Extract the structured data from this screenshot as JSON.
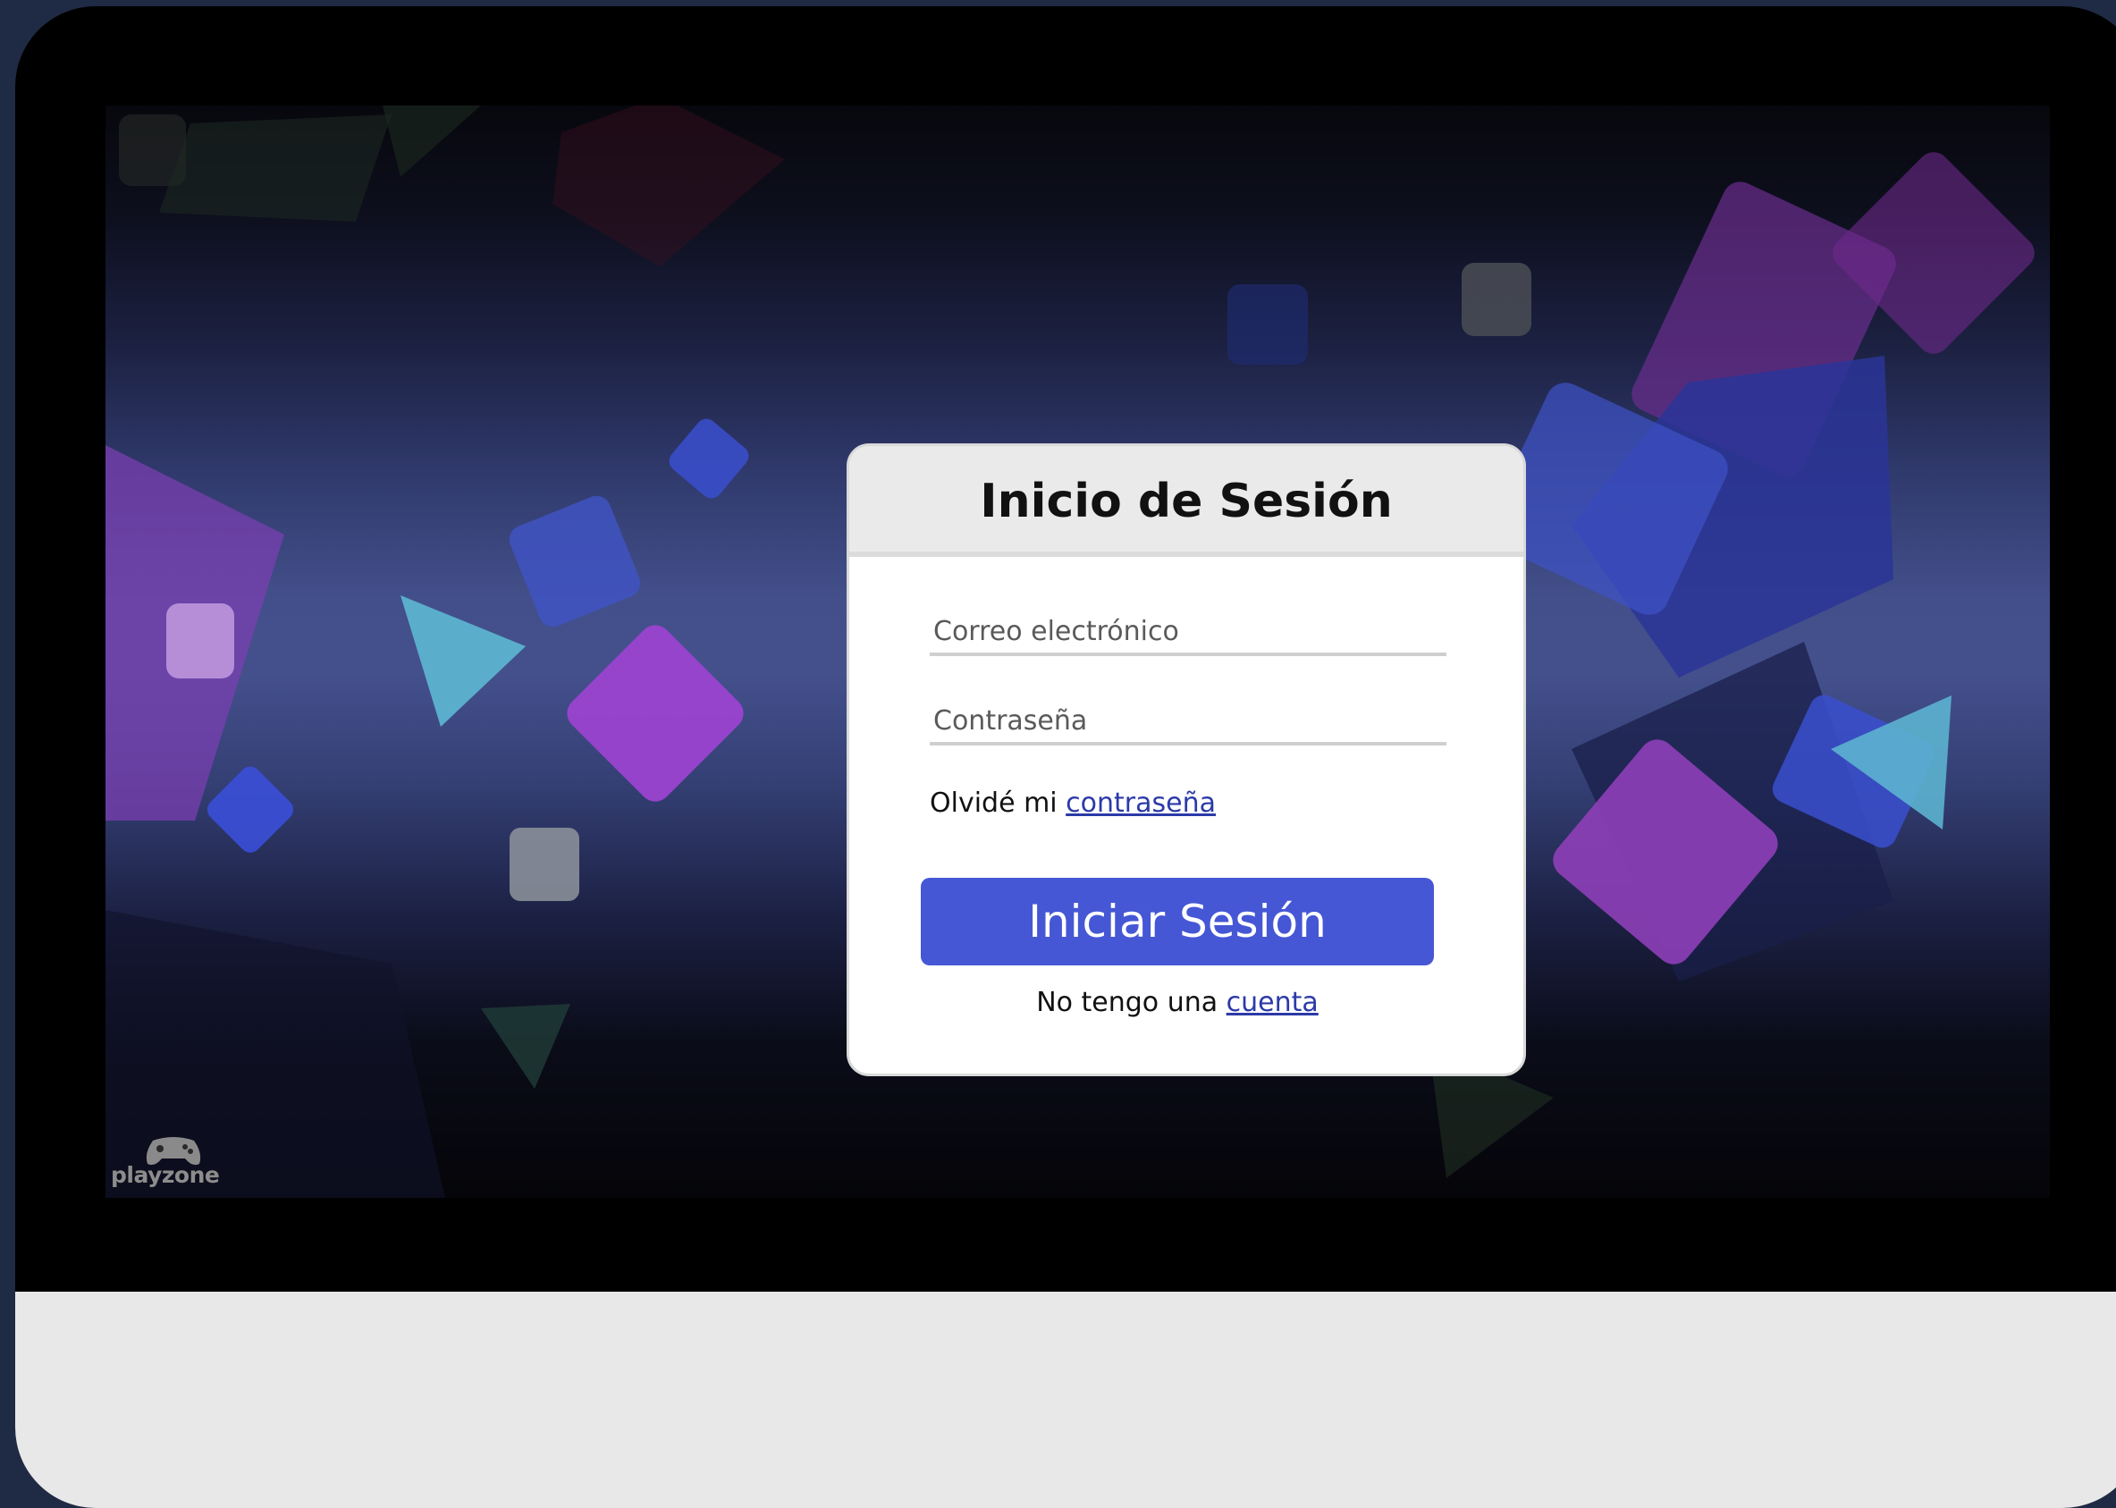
{
  "login": {
    "title": "Inicio de Sesión",
    "email_placeholder": "Correo electrónico",
    "password_placeholder": "Contraseña",
    "forgot_prefix": "Olvidé mi ",
    "forgot_link": "contraseña",
    "submit_label": "Iniciar Sesión",
    "register_prefix": "No tengo una ",
    "register_link": "cuenta"
  },
  "brand": {
    "logo_text": "playzone",
    "logo_icon": "gamepad-icon"
  },
  "colors": {
    "accent": "#4557d5",
    "link": "#2b3aa8",
    "frame": "#000000",
    "chin": "#e8e8e8"
  }
}
